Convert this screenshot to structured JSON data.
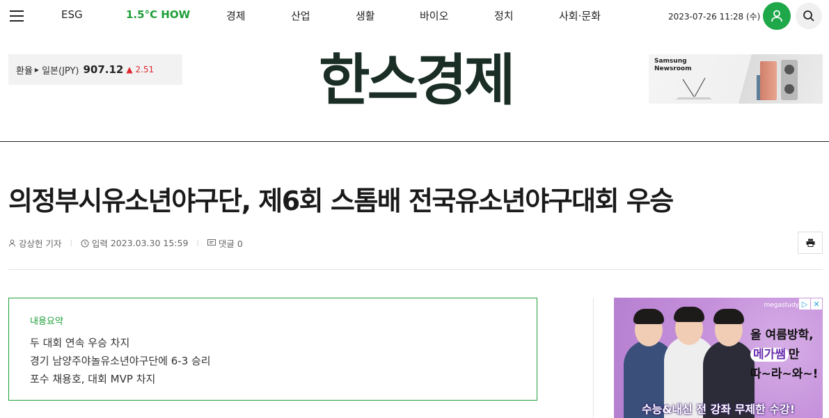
{
  "nav": {
    "items": [
      {
        "label": "ESG"
      },
      {
        "label": "1.5°C HOW"
      },
      {
        "label": "경제"
      },
      {
        "label": "산업"
      },
      {
        "label": "생활"
      },
      {
        "label": "바이오"
      },
      {
        "label": "정치"
      },
      {
        "label": "사회·문화"
      }
    ],
    "datetime": "2023-07-26 11:28 (수)",
    "highlight_color": "#1e9e38"
  },
  "exchange": {
    "label": "환율",
    "country": "일본(JPY)",
    "value": "907.12",
    "change_symbol": "▲",
    "change": "2.51"
  },
  "logo": {
    "text": "한스경제"
  },
  "header_ad": {
    "brand_line1": "Samsung",
    "brand_line2": "Newsroom"
  },
  "article": {
    "headline": "의정부시유소년야구단, 제6회 스톰배 전국유소년야구대회 우승",
    "author": "강상헌 기자",
    "date_label": "입력",
    "date": "2023.03.30 15:59",
    "comments_label": "댓글",
    "comments_count": "0"
  },
  "summary": {
    "title": "내용요약",
    "items": [
      "두 대회 연속 우승 차지",
      "경기 남양주야놀유소년야구단에 6-3 승리",
      "포수 채용호, 대회 MVP 차지"
    ]
  },
  "side_ad": {
    "brand": "megastudy",
    "line1": "올 여름방학,",
    "line2a": "메가쌤",
    "line2b": "만",
    "line3": "따~라~와~!",
    "bottom": "수능&내신 전 강좌 무제한 수강!"
  }
}
